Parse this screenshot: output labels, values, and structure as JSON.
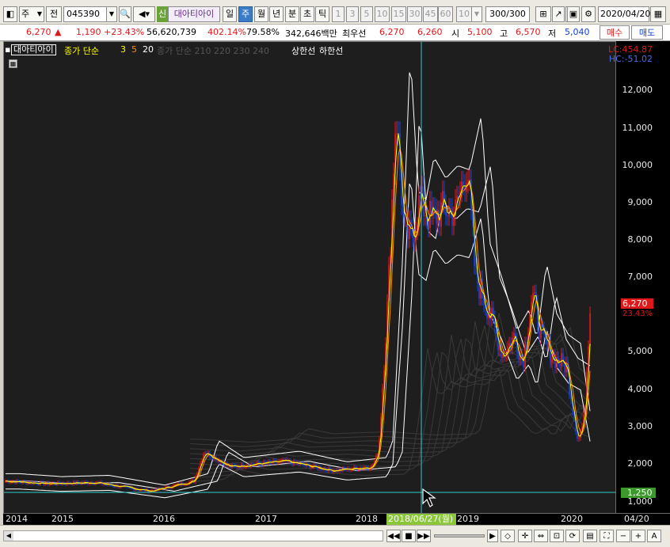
{
  "toolbar": {
    "period_code": "주",
    "prev_label": "전",
    "stock_code": "045390",
    "credit_label": "신",
    "stock_name": "대아티아이",
    "tf_day": "일",
    "tf_week": "주",
    "tf_month": "월",
    "tf_year": "년",
    "tf_min": "분",
    "tf_sec": "초",
    "tf_tick": "틱",
    "n1": "1",
    "n3": "3",
    "n5": "5",
    "n10": "10",
    "n15": "15",
    "n30": "30",
    "n45": "45",
    "n60": "60",
    "n10b": "10",
    "count": "300",
    "count_total": "/300",
    "date": "2020/04/20"
  },
  "quote": {
    "price": "6,270",
    "arrow": "▲",
    "change": "1,190",
    "change_pct": "+23.43%",
    "volume": "56,620,739",
    "vol_ratio": "402.14%",
    "turnover": "79.58%",
    "amount": "342,646백만",
    "prio_label": "최우선",
    "prio_sell": "6,270",
    "prio_buy": "6,260",
    "open_label": "시",
    "open": "5,100",
    "high_label": "고",
    "high": "6,570",
    "low_label": "저",
    "low": "5,040",
    "buy_btn": "매수",
    "sell_btn": "매도"
  },
  "legend": {
    "name": "대아티아이",
    "ma_label": "종가 단순",
    "ma3": "3",
    "ma5": "5",
    "ma20": "20",
    "ma_long": "종가 단순 210  220  230  240",
    "upper": "상한선",
    "lower": "하한선"
  },
  "axis": {
    "lc": "LC:454.87",
    "hc": "HC:-51.02",
    "price_labels": [
      "12,000",
      "11,000",
      "10,000",
      "9,000",
      "8,000",
      "7,000",
      "5,000",
      "4,000",
      "3,000",
      "2,000",
      "1,000"
    ],
    "current_price": "6,270",
    "current_pct": "23.43%",
    "cursor_price": "1,250",
    "x_labels": [
      "2014",
      "2015",
      "2016",
      "2017",
      "2018",
      "2019",
      "2020"
    ],
    "cursor_date": "2018/06/27(월)",
    "right_date": "04/20"
  },
  "colors": {
    "up": "#e0181a",
    "down": "#1442d8",
    "ma3": "#ffff00",
    "ma5": "#ff8c00",
    "ma20": "#ffffff",
    "cursor": "#33cccc"
  },
  "chart_data": {
    "type": "candlestick",
    "timeframe": "weekly",
    "ylim": [
      1000,
      12500
    ],
    "approx_close": [
      [
        "2014",
        1500
      ],
      [
        "2015",
        1450
      ],
      [
        "2016",
        1550
      ],
      [
        "2016-08",
        2300
      ],
      [
        "2017",
        1950
      ],
      [
        "2018",
        1800
      ],
      [
        "2018-03",
        11500
      ],
      [
        "2018-06",
        8000
      ],
      [
        "2019",
        8700
      ],
      [
        "2019-03",
        10000
      ],
      [
        "2019-06",
        6000
      ],
      [
        "2019-09",
        5000
      ],
      [
        "2020",
        4500
      ],
      [
        "2020-03",
        2600
      ],
      [
        "2020-04-20",
        6270
      ]
    ],
    "series": [
      {
        "name": "3",
        "type": "ma"
      },
      {
        "name": "5",
        "type": "ma"
      },
      {
        "name": "20",
        "type": "ma"
      },
      {
        "name": "상한선",
        "type": "envelope"
      },
      {
        "name": "하한선",
        "type": "envelope"
      }
    ]
  }
}
